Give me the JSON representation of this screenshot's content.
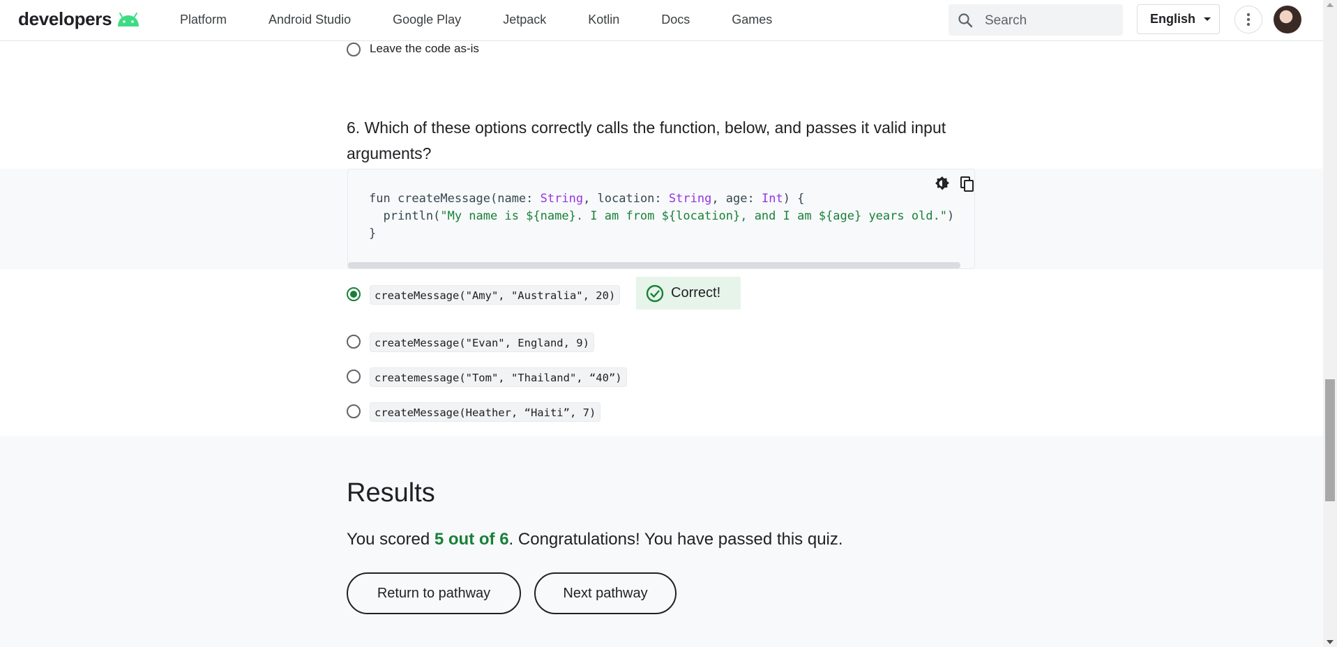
{
  "header": {
    "logo_text": "developers",
    "nav": [
      "Platform",
      "Android Studio",
      "Google Play",
      "Jetpack",
      "Kotlin",
      "Docs",
      "Games"
    ],
    "search_placeholder": "Search",
    "language": "English"
  },
  "prev_option": {
    "label": "Leave the code as-is"
  },
  "question": {
    "text": "6. Which of these options correctly calls the function, below, and passes it valid input arguments?",
    "code_lines": [
      "fun createMessage(name: String, location: String, age: Int) {",
      "  println(\"My name is ${name}. I am from ${location}, and I am ${age} years old.\")",
      "}"
    ],
    "options": [
      "createMessage(\"Amy\", \"Australia\", 20)",
      "createMessage(\"Evan\", England, 9)",
      "createmessage(\"Tom\", \"Thailand\", “40”)",
      "createMessage(Heather, “Haiti”, 7)"
    ],
    "selected_index": 0,
    "feedback": "Correct!"
  },
  "results": {
    "title": "Results",
    "prefix": "You scored ",
    "score": "5 out of 6",
    "suffix": ". Congratulations! You have passed this quiz.",
    "return_button": "Return to pathway",
    "next_button": "Next pathway"
  },
  "colors": {
    "accent_green": "#188038",
    "type_purple": "#9334e6",
    "android_green": "#3ddc84"
  },
  "icons": [
    "android-icon",
    "search-icon",
    "caret-down-icon",
    "more-vert-icon",
    "theme-toggle-icon",
    "copy-icon",
    "check-circle-icon"
  ]
}
